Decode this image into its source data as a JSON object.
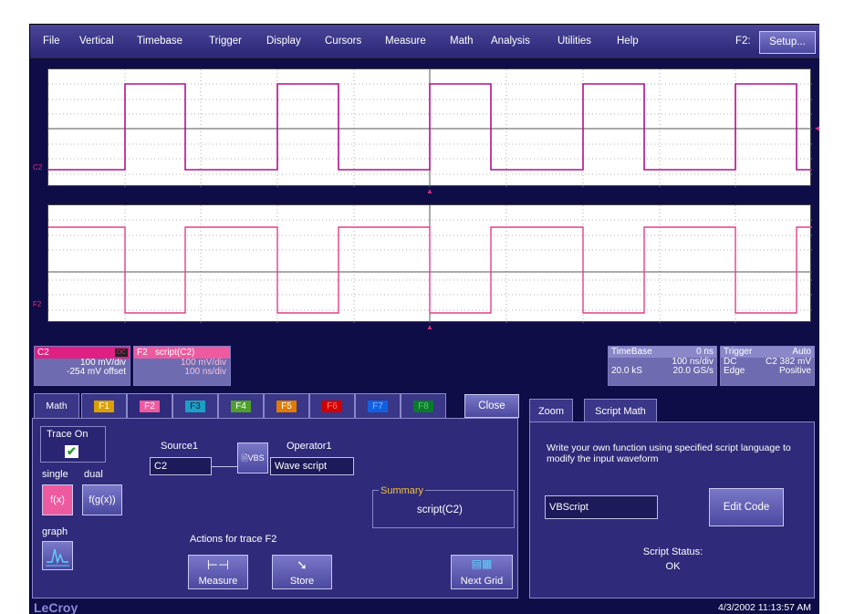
{
  "menu": {
    "items": [
      "File",
      "Vertical",
      "Timebase",
      "Trigger",
      "Display",
      "Cursors",
      "Measure",
      "Math",
      "Analysis",
      "Utilities",
      "Help"
    ],
    "function_label": "F2:",
    "setup_label": "Setup..."
  },
  "grids": {
    "grid1_trace_label": "C2",
    "grid2_trace_label": "F2"
  },
  "colors": {
    "c2": "#e01f82",
    "f2": "#ee5aa0",
    "panel": "#2f2a7a",
    "accent": "#4b48a0"
  },
  "channel_c2": {
    "name": "C2",
    "coupling": "DC",
    "scale": "100 mV/div",
    "offset": "-254 mV offset"
  },
  "channel_f2": {
    "name": "F2",
    "func": "script(C2)",
    "scale": "100 mV/div",
    "timescale": "100 ns/div"
  },
  "timebase": {
    "label": "TimeBase",
    "delay": "0 ns",
    "scale": "100 ns/div",
    "samples": "20.0 kS",
    "rate": "20.0 GS/s"
  },
  "trigger": {
    "label": "Trigger",
    "mode": "Auto",
    "coupling": "DC",
    "level": "C2 382 mV",
    "type": "Edge",
    "slope": "Positive"
  },
  "dialog": {
    "tabs": [
      "Math",
      "F1",
      "F2",
      "F3",
      "F4",
      "F5",
      "F6",
      "F7",
      "F8"
    ],
    "close_label": "Close",
    "trace_on_label": "Trace On",
    "single_label": "single",
    "dual_label": "dual",
    "single_glyph": "f(x)",
    "dual_glyph": "f(g(x))",
    "graph_label": "graph",
    "source_label": "Source1",
    "source_value": "C2",
    "vbs_label": "VBS",
    "operator_label": "Operator1",
    "operator_value": "Wave script",
    "summary_label": "Summary",
    "summary_value": "script(C2)",
    "actions_label": "Actions for trace F2",
    "measure_label": "Measure",
    "store_label": "Store",
    "nextgrid_label": "Next Grid"
  },
  "right_panel": {
    "tab_zoom": "Zoom",
    "tab_script": "Script Math",
    "description": "Write your own function using specified script language to modify the input waveform",
    "language": "VBScript",
    "edit_code_label": "Edit Code",
    "status_label": "Script Status:",
    "status_value": "OK"
  },
  "footer": {
    "logo": "LeCroy",
    "timestamp": "4/3/2002 11:13:57 AM"
  }
}
